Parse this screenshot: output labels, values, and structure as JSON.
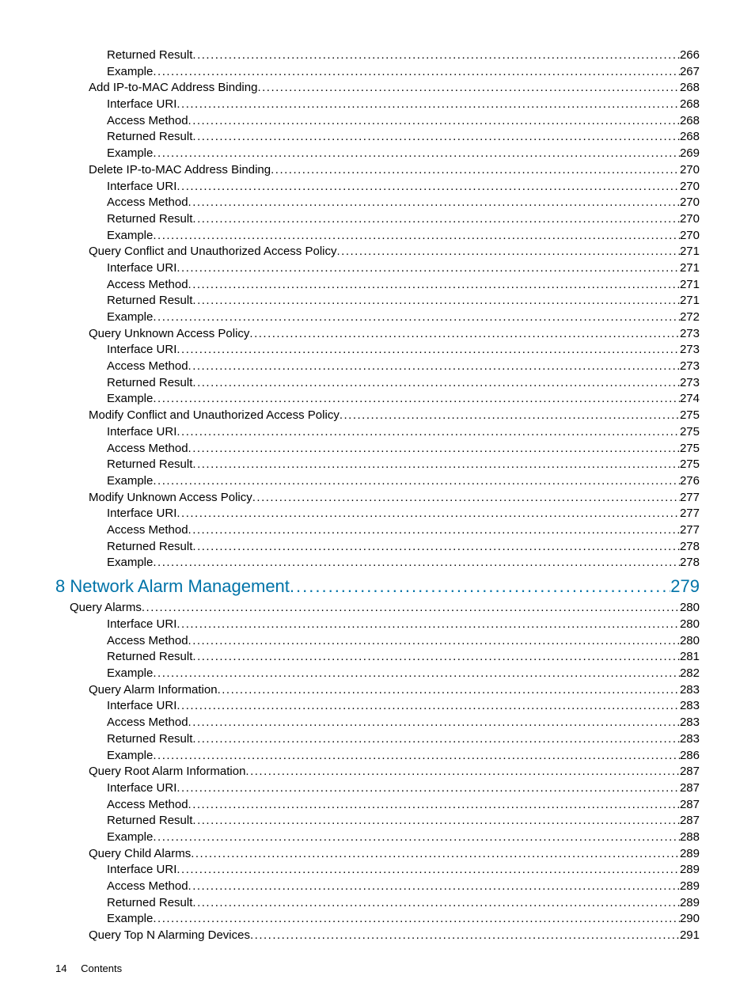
{
  "toc": [
    {
      "level": "level3",
      "label": "Returned Result",
      "page": "266"
    },
    {
      "level": "level3",
      "label": "Example",
      "page": "267"
    },
    {
      "level": "level2",
      "label": "Add IP-to-MAC Address Binding",
      "page": "268"
    },
    {
      "level": "level3",
      "label": "Interface URI",
      "page": "268"
    },
    {
      "level": "level3",
      "label": "Access Method",
      "page": "268"
    },
    {
      "level": "level3",
      "label": "Returned Result",
      "page": "268"
    },
    {
      "level": "level3",
      "label": "Example",
      "page": "269"
    },
    {
      "level": "level2",
      "label": "Delete IP-to-MAC Address Binding",
      "page": "270"
    },
    {
      "level": "level3",
      "label": "Interface URI",
      "page": "270"
    },
    {
      "level": "level3",
      "label": "Access Method",
      "page": "270"
    },
    {
      "level": "level3",
      "label": "Returned Result",
      "page": "270"
    },
    {
      "level": "level3",
      "label": "Example",
      "page": "270"
    },
    {
      "level": "level2",
      "label": "Query Conflict and Unauthorized Access Policy",
      "page": "271"
    },
    {
      "level": "level3",
      "label": "Interface URI",
      "page": "271"
    },
    {
      "level": "level3",
      "label": "Access Method",
      "page": "271"
    },
    {
      "level": "level3",
      "label": "Returned Result",
      "page": "271"
    },
    {
      "level": "level3",
      "label": "Example",
      "page": "272"
    },
    {
      "level": "level2",
      "label": "Query Unknown Access Policy",
      "page": "273"
    },
    {
      "level": "level3",
      "label": "Interface URI",
      "page": "273"
    },
    {
      "level": "level3",
      "label": "Access Method",
      "page": "273"
    },
    {
      "level": "level3",
      "label": "Returned Result",
      "page": "273"
    },
    {
      "level": "level3",
      "label": "Example",
      "page": "274"
    },
    {
      "level": "level2",
      "label": "Modify Conflict and Unauthorized Access Policy",
      "page": "275"
    },
    {
      "level": "level3",
      "label": "Interface URI",
      "page": "275"
    },
    {
      "level": "level3",
      "label": "Access Method",
      "page": "275"
    },
    {
      "level": "level3",
      "label": "Returned Result",
      "page": "275"
    },
    {
      "level": "level3",
      "label": "Example",
      "page": "276"
    },
    {
      "level": "level2",
      "label": "Modify Unknown Access Policy",
      "page": "277"
    },
    {
      "level": "level3",
      "label": "Interface URI",
      "page": "277"
    },
    {
      "level": "level3",
      "label": "Access Method",
      "page": "277"
    },
    {
      "level": "level3",
      "label": "Returned Result",
      "page": "278"
    },
    {
      "level": "level3",
      "label": "Example",
      "page": "278"
    },
    {
      "level": "chapter",
      "label": "8 Network Alarm Management",
      "page": "279"
    },
    {
      "level": "level1",
      "label": "Query Alarms",
      "page": "280"
    },
    {
      "level": "level3",
      "label": "Interface URI",
      "page": "280"
    },
    {
      "level": "level3",
      "label": "Access Method",
      "page": "280"
    },
    {
      "level": "level3",
      "label": "Returned Result",
      "page": "281"
    },
    {
      "level": "level3",
      "label": "Example",
      "page": "282"
    },
    {
      "level": "level2",
      "label": "Query Alarm Information",
      "page": "283"
    },
    {
      "level": "level3",
      "label": "Interface URI",
      "page": "283"
    },
    {
      "level": "level3",
      "label": "Access Method",
      "page": "283"
    },
    {
      "level": "level3",
      "label": "Returned Result",
      "page": "283"
    },
    {
      "level": "level3",
      "label": "Example",
      "page": "286"
    },
    {
      "level": "level2",
      "label": "Query Root Alarm Information",
      "page": "287"
    },
    {
      "level": "level3",
      "label": "Interface URI",
      "page": "287"
    },
    {
      "level": "level3",
      "label": "Access Method",
      "page": "287"
    },
    {
      "level": "level3",
      "label": "Returned Result",
      "page": "287"
    },
    {
      "level": "level3",
      "label": "Example",
      "page": "288"
    },
    {
      "level": "level2",
      "label": "Query Child Alarms",
      "page": "289"
    },
    {
      "level": "level3",
      "label": "Interface URI",
      "page": "289"
    },
    {
      "level": "level3",
      "label": "Access Method",
      "page": "289"
    },
    {
      "level": "level3",
      "label": "Returned Result",
      "page": "289"
    },
    {
      "level": "level3",
      "label": "Example",
      "page": "290"
    },
    {
      "level": "level2",
      "label": "Query Top N Alarming Devices",
      "page": "291"
    }
  ],
  "footer": {
    "page_number": "14",
    "section": "Contents"
  }
}
